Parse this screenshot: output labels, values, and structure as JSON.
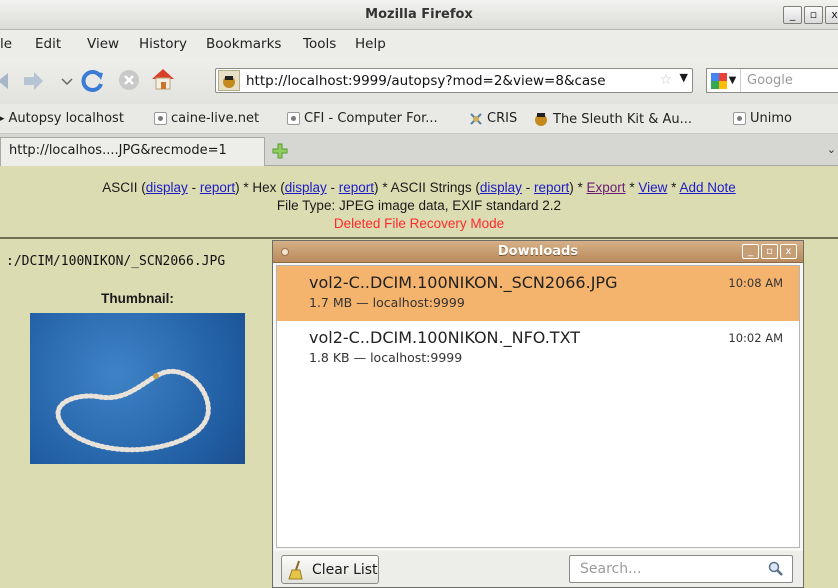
{
  "window": {
    "title": "Mozilla Firefox",
    "buttons": [
      "_",
      "▫",
      "x"
    ]
  },
  "menubar": {
    "items": [
      "le",
      "Edit",
      "View",
      "History",
      "Bookmarks",
      "Tools",
      "Help"
    ]
  },
  "navbar": {
    "url": "http://localhost:9999/autopsy?mod=2&view=8&case",
    "search_placeholder": "Google"
  },
  "bookmarks": [
    "Autopsy localhost",
    "caine-live.net",
    "CFI - Computer For...",
    "CRIS",
    "The Sleuth Kit & Au...",
    "Unimo"
  ],
  "tab": {
    "label": "http://localhos....JPG&recmode=1"
  },
  "page": {
    "ascii": "ASCII",
    "hex": "Hex",
    "ascii_strings": "ASCII Strings",
    "display": "display",
    "report": "report",
    "export": "Export",
    "view": "View",
    "add_note": "Add Note",
    "open_paren": "(",
    "close_paren": ")",
    "dash": "-",
    "sep": "*",
    "file_type": "File Type: JPEG image data, EXIF standard 2.2",
    "recovery_mode": "Deleted File Recovery Mode",
    "path": ":/DCIM/100NIKON/_SCN2066.JPG",
    "thumbnail_label": "Thumbnail:"
  },
  "downloads": {
    "title": "Downloads",
    "items": [
      {
        "name": "vol2-C..DCIM.100NIKON._SCN2066.JPG",
        "meta": "1.7 MB — localhost:9999",
        "time": "10:08 AM"
      },
      {
        "name": "vol2-C..DCIM.100NIKON._NFO.TXT",
        "meta": "1.8 KB — localhost:9999",
        "time": "10:02 AM"
      }
    ],
    "clear_button": "Clear List",
    "search_placeholder": "Search..."
  },
  "colors": {
    "selected_row": "#f5b46e",
    "page_bg": "#dcdcb2",
    "link": "#1b1bc8",
    "recovery": "#ff2a2a"
  }
}
